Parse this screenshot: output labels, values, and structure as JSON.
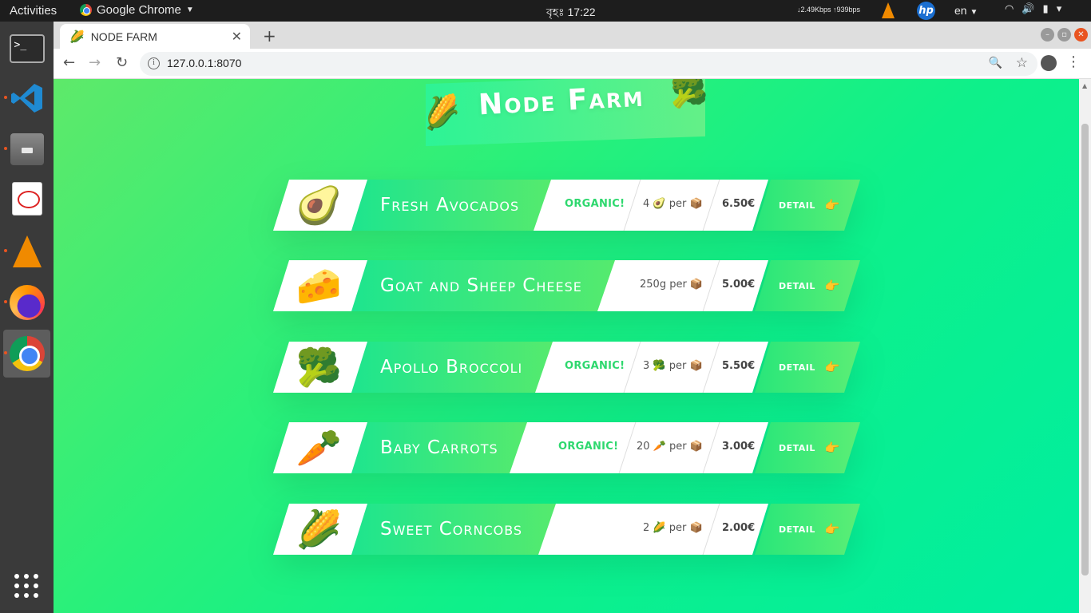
{
  "topbar": {
    "activities": "Activities",
    "app_name": "Google Chrome",
    "clock": "বৃহঃ 17:22",
    "network": "↓2.49Kbps ↑939bps",
    "language": "en"
  },
  "browser": {
    "tab_title": "NODE FARM",
    "tab_favicon": "🌽",
    "url": "127.0.0.1:8070"
  },
  "page": {
    "heading": "Node Farm",
    "heading_emoji_left": "🌽",
    "heading_emoji_right": "🥦",
    "detail_label": "DETAIL",
    "detail_pointer": "👉",
    "products": [
      {
        "name": "Fresh Avocados",
        "image": "🥑",
        "organic": "ORGANIC!",
        "qty": "4 🥑 per 📦",
        "price": "6.50€"
      },
      {
        "name": "Goat and Sheep Cheese",
        "image": "🧀",
        "organic": "",
        "qty": "250g per 📦",
        "price": "5.00€"
      },
      {
        "name": "Apollo Broccoli",
        "image": "🥦",
        "organic": "ORGANIC!",
        "qty": "3 🥦 per 📦",
        "price": "5.50€"
      },
      {
        "name": "Baby Carrots",
        "image": "🥕",
        "organic": "ORGANIC!",
        "qty": "20 🥕 per 📦",
        "price": "3.00€"
      },
      {
        "name": "Sweet Corncobs",
        "image": "🌽",
        "organic": "",
        "qty": "2 🌽 per 📦",
        "price": "2.00€"
      }
    ]
  },
  "colors": {
    "accent_green": "#2ed86e",
    "gradient_start": "#5ee96a",
    "gradient_end": "#00eea0"
  }
}
